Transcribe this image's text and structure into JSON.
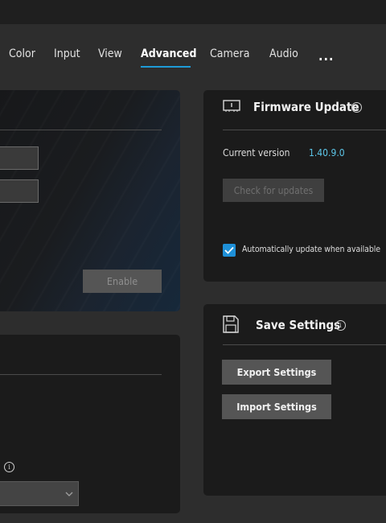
{
  "tabs": [
    {
      "label": "Color"
    },
    {
      "label": "Input"
    },
    {
      "label": "View"
    },
    {
      "label": "Advanced",
      "active": true
    },
    {
      "label": "Camera"
    },
    {
      "label": "Audio"
    }
  ],
  "more_label": "...",
  "left_panel": {
    "enable_label": "Enable"
  },
  "firmware": {
    "title": "Firmware Update",
    "current_version_label": "Current version",
    "current_version_value": "1.40.9.0",
    "check_button": "Check for updates",
    "auto_update_label": "Automatically update when available",
    "auto_update_checked": true
  },
  "save_settings": {
    "title": "Save Settings",
    "export_button": "Export Settings",
    "import_button": "Import Settings"
  },
  "colors": {
    "accent": "#1e9bd7",
    "version_text": "#5cc6e8"
  }
}
